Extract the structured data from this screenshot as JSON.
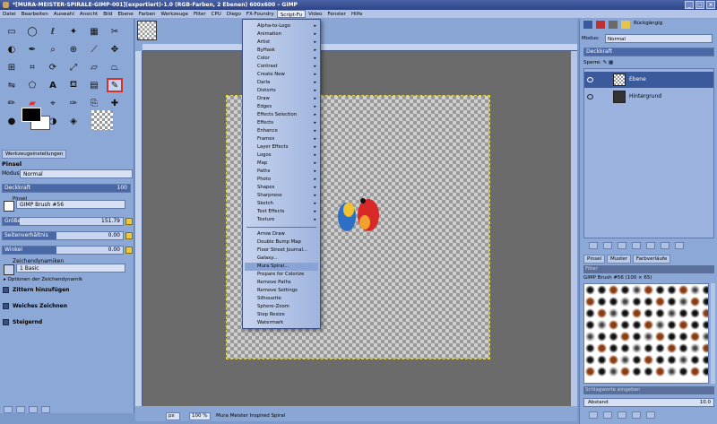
{
  "window": {
    "title": "*[MURA-MEISTER-SPIRALE-GIMP-001](exportiert)-1.0 (RGB-Farben, 2 Ebenen) 600x600 – GIMP"
  },
  "menubar": [
    "Datei",
    "Bearbeiten",
    "Auswahl",
    "Ansicht",
    "Bild",
    "Ebene",
    "Farben",
    "Werkzeuge",
    "Filter",
    "CPU",
    "Diego",
    "FX-Foundry",
    "Script-Fu",
    "Video",
    "Fenster",
    "Hilfe"
  ],
  "left": {
    "tab": "Werkzeugeinstellungen",
    "tool_title": "Pinsel",
    "mode_label": "Modus:",
    "mode_value": "Normal",
    "opacity_label": "Deckkraft",
    "opacity_value": "100",
    "brush_label": "Pinsel",
    "brush_value": "GIMP Brush #56",
    "size_label": "Größe",
    "size_value": "151.79",
    "aspect_label": "Seitenverhältnis",
    "aspect_value": "0.00",
    "angle_label": "Winkel",
    "angle_value": "0.00",
    "dynamics_label": "Zeichendynamiken",
    "dynamics_value": "1 Basic",
    "dyn_options": "Optionen der Zeichendynamik",
    "checks": [
      "Zittern hinzufügen",
      "Weiches Zeichnen",
      "Steigernd"
    ]
  },
  "submenu": {
    "items": [
      "Alpha-to-Logo",
      "Animation",
      "Artist",
      "ByHask",
      "Color",
      "Contrast",
      "Create New",
      "Darla",
      "Distorts",
      "Draw",
      "Edges",
      "Effects Selection",
      "Effects",
      "Enhance",
      "Frames",
      "Layer Effects",
      "Logos",
      "Map",
      "Paths",
      "Photo",
      "Shapes",
      "Sharpness",
      "Sketch",
      "Text Effects",
      "Texture"
    ],
    "items2": [
      "Arrow Draw",
      "Double Bump Map",
      "Floor Street Journal...",
      "Galaxy...",
      "Mura Spiral...",
      "Prepare for Colorize",
      "Remove Paths",
      "Remove Settings",
      "Silhouette",
      "Sphere-Zoom",
      "Step Resize",
      "Watermark"
    ],
    "highlighted": "Mura Spiral..."
  },
  "status": {
    "unit": "px",
    "zoom": "100 %",
    "message": "Mura Meister Inspired Spiral"
  },
  "right": {
    "undo_tab": "Rückgängig",
    "mode_label": "Modus:",
    "mode_value": "Normal",
    "opacity_label": "Deckkraft",
    "lock_label": "Sperre:",
    "layers": [
      "Ebene",
      "Hintergrund"
    ],
    "brush_tabs": [
      "Pinsel",
      "Muster",
      "Farbverläufe"
    ],
    "filter_placeholder": "Filter",
    "brush_name": "GIMP Brush #56 (100 × 65)",
    "tag_placeholder": "Schlagworte eingeben",
    "spacing_label": "Abstand",
    "spacing_value": "10.0"
  }
}
